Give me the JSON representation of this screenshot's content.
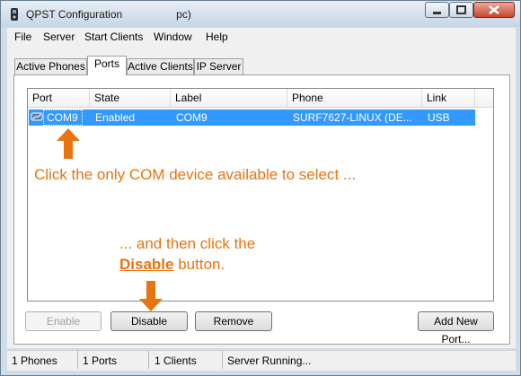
{
  "window": {
    "title": "QPST Configuration                  pc)"
  },
  "menubar": {
    "items": [
      "File",
      "Server",
      "Start Clients",
      "Window",
      "Help"
    ]
  },
  "tabs": [
    {
      "label": "Active Phones",
      "active": false
    },
    {
      "label": "Ports",
      "active": true
    },
    {
      "label": "Active Clients",
      "active": false
    },
    {
      "label": "IP Server",
      "active": false
    }
  ],
  "table": {
    "columns": [
      "Port",
      "State",
      "Label",
      "Phone",
      "Link"
    ],
    "rows": [
      {
        "port": "COM9",
        "state": "Enabled",
        "label": "COM9",
        "phone": "SURF7627-LINUX (DE...",
        "link": "USB",
        "selected": true
      }
    ]
  },
  "annotations": {
    "select_hint": "Click the only COM device available to select ...",
    "disable_hint_line1": "... and then click the",
    "disable_hint_bold": "Disable",
    "disable_hint_rest": " button.",
    "color": "#e8730f"
  },
  "buttons": {
    "enable": "Enable",
    "disable": "Disable",
    "remove": "Remove",
    "add_new_port": "Add New Port..."
  },
  "statusbar": {
    "phones": "1 Phones",
    "ports": "1 Ports",
    "clients": "1 Clients",
    "server": "Server Running..."
  },
  "colors": {
    "selection": "#3399ff",
    "accent": "#e8730f"
  }
}
